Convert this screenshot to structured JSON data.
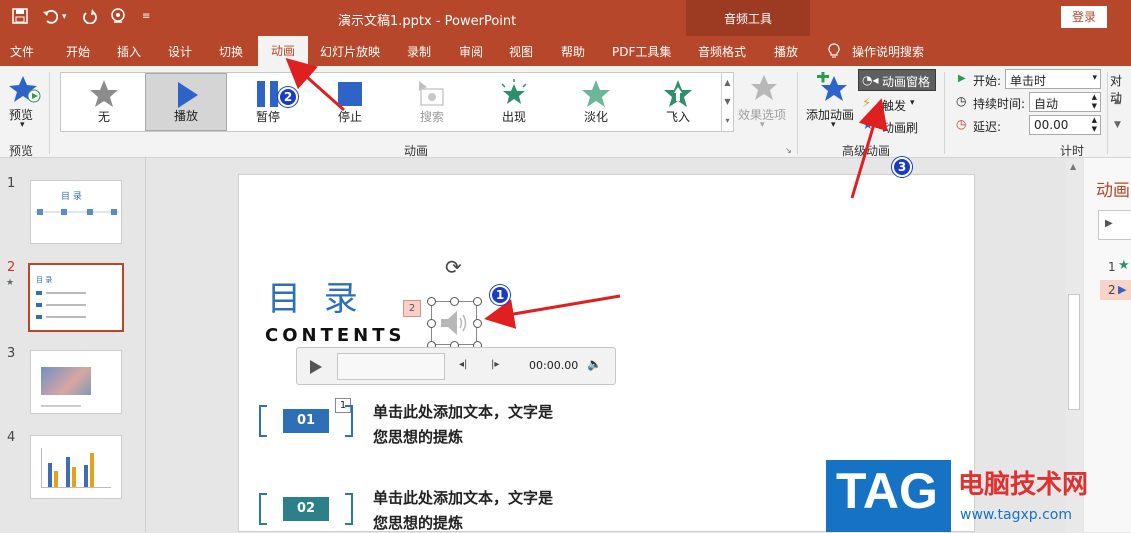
{
  "titlebar": {
    "doc_title": "演示文稿1.pptx  -  PowerPoint",
    "context_group": "音频工具",
    "login": "登录"
  },
  "tabs": [
    "文件",
    "开始",
    "插入",
    "设计",
    "切换",
    "动画",
    "幻灯片放映",
    "录制",
    "审阅",
    "视图",
    "帮助",
    "PDF工具集",
    "音频格式",
    "播放"
  ],
  "tell_me": "操作说明搜索",
  "ribbon": {
    "preview": {
      "label": "预览",
      "group": "预览"
    },
    "gallery": [
      "无",
      "播放",
      "暂停",
      "停止",
      "搜索",
      "出现",
      "淡化",
      "飞入"
    ],
    "effect_options": "效果选项",
    "group_animation": "动画",
    "add_animation": "添加动画",
    "anim_pane": "动画窗格",
    "trigger": "触发",
    "anim_painter": "动画刷",
    "group_advanced": "高级动画",
    "start_label": "开始:",
    "start_value": "单击时",
    "duration_label": "持续时间:",
    "duration_value": "自动",
    "delay_label": "延迟:",
    "delay_value": "00.00",
    "group_timing": "计时",
    "reorder_label": "对动"
  },
  "thumbnails": [
    {
      "num": "1",
      "title": "目 录"
    },
    {
      "num": "2",
      "title": "目 录"
    },
    {
      "num": "3",
      "title": ""
    },
    {
      "num": "4",
      "title": ""
    }
  ],
  "slide": {
    "title": "目 录",
    "subtitle": "CONTENTS",
    "anim_tag_audio": "2",
    "anim_tag_item": "1",
    "player_time": "00:00.00",
    "items": [
      {
        "num": "01",
        "text_line1": "单击此处添加文本，文字是",
        "text_line2": "您思想的提炼"
      },
      {
        "num": "02",
        "text_line1": "单击此处添加文本，文字是",
        "text_line2": "您思想的提炼"
      }
    ]
  },
  "anim_pane": {
    "title": "动画",
    "entries": [
      "1",
      "2"
    ]
  },
  "callouts": [
    "1",
    "2",
    "3"
  ],
  "watermark": {
    "logo": "TAG",
    "site_name": "电脑技术网",
    "url": "www.tagxp.com"
  },
  "colors": {
    "accent": "#b7472a",
    "slide_blue": "#2f6fb5",
    "badge": "#1a3bc9",
    "arrow": "#e02020"
  }
}
